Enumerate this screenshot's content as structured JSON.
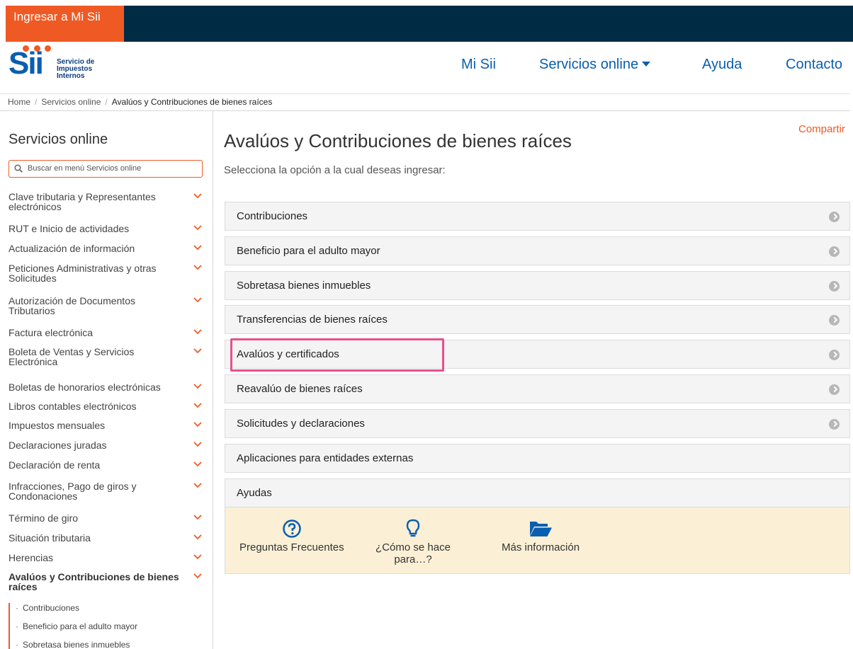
{
  "topbar": {
    "login_label": "Ingresar a Mi Sii"
  },
  "logo": {
    "word": "Sii",
    "line1": "Servicio de",
    "line2": "Impuestos",
    "line3": "Internos"
  },
  "nav": {
    "mi_sii": "Mi Sii",
    "servicios": "Servicios online",
    "ayuda": "Ayuda",
    "contacto": "Contacto"
  },
  "breadcrumb": {
    "home": "Home",
    "sep": "/",
    "servicios": "Servicios online",
    "current": "Avalúos y Contribuciones de bienes raíces"
  },
  "sidebar": {
    "title": "Servicios online",
    "search_placeholder": "Buscar en menú Servicios online",
    "items": [
      "Clave tributaria y Representantes electrónicos",
      "RUT e Inicio de actividades",
      "Actualización de información",
      "Peticiones Administrativas y otras Solicitudes",
      "Autorización de Documentos Tributarios",
      "Factura electrónica",
      "Boleta de Ventas y Servicios Electrónica",
      "Boletas de honorarios electrónicas",
      "Libros contables electrónicos",
      "Impuestos mensuales",
      "Declaraciones juradas",
      "Declaración de renta",
      "Infracciones, Pago de giros y Condonaciones",
      "Término de giro",
      "Situación tributaria",
      "Herencias",
      "Avalúos y Contribuciones de bienes raíces"
    ],
    "sub_items": [
      "Contribuciones",
      "Beneficio para el adulto mayor",
      "Sobretasa bienes inmuebles"
    ],
    "bullet": "·"
  },
  "main": {
    "share": "Compartir",
    "title": "Avalúos y Contribuciones de bienes raíces",
    "subtitle": "Selecciona la opción a la cual deseas ingresar:",
    "accordions": [
      "Contribuciones",
      "Beneficio para el adulto mayor",
      "Sobretasa bienes inmuebles",
      "Transferencias de bienes raíces",
      "Avalúos y certificados",
      "Reavalúo de bienes raíces",
      "Solicitudes y declaraciones",
      "Aplicaciones para entidades externas",
      "Ayudas"
    ],
    "highlighted": "Avalúos y certificados",
    "help": {
      "faq": "Preguntas Frecuentes",
      "howto_line1": "¿Cómo se hace",
      "howto_line2": "para…?",
      "more": "Más información"
    }
  },
  "colors": {
    "orange": "#ef5a24",
    "navy": "#002b45",
    "blue": "#0a5eb0",
    "highlight": "#e8508a"
  }
}
